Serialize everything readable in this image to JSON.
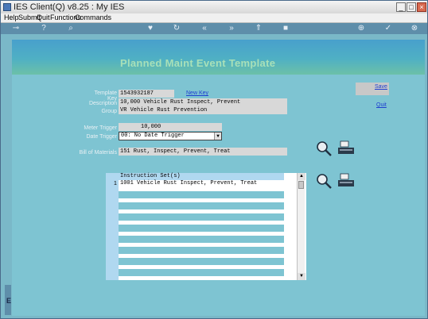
{
  "window": {
    "title": "IES Client(Q) v8.25 : My IES"
  },
  "menu": [
    {
      "label": "Help",
      "key": "help"
    },
    {
      "label": "Submit",
      "key": "submit"
    },
    {
      "label": "Quit",
      "key": "quit"
    },
    {
      "label": "Functions",
      "key": "functions"
    },
    {
      "label": "Commands",
      "key": "commands"
    }
  ],
  "page": {
    "title": "Planned Maint Event Template"
  },
  "form": {
    "template_key_label": "Template Key",
    "template_key_value": "1543932187",
    "new_key_label": "New Key",
    "description_label": "Description",
    "description_value": "10,000 Vehicle Rust Inspect, Prevent",
    "group_label": "Group",
    "group_value": "VR Vehicle Rust Prevention",
    "meter_trigger_label": "Meter Trigger",
    "meter_trigger_value": "10,000",
    "date_trigger_label": "Date Trigger",
    "date_trigger_value": "00: No Date Trigger",
    "bom_label": "Bill of Materials",
    "bom_value": "151 Rust, Inspect, Prevent, Treat"
  },
  "actions": {
    "save_label": "Save",
    "quit_label": "Quit"
  },
  "instructions": {
    "header": "Instruction Set(s)",
    "row_indicator": "1",
    "rows": [
      "1001 Vehicle Rust Inspect, Prevent, Treat"
    ]
  },
  "side": {
    "letter": "E"
  },
  "colors": {
    "background": "#7ec4d2",
    "title": "#a8e0b8",
    "link": "#1f3fd0"
  }
}
